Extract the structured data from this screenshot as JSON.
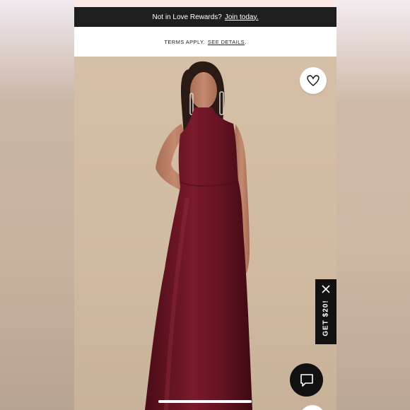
{
  "promo": {
    "text": "Not in Love Rewards?",
    "link": "Join today."
  },
  "terms": {
    "text": "TERMS APPLY.",
    "link": "SEE DETAILS",
    "period": "."
  },
  "get20": {
    "label": "GET $20!",
    "close_icon": "close-icon"
  },
  "icons": {
    "favorite": "heart-icon",
    "chat": "chat-bubble-icon"
  },
  "colors": {
    "promo_bar": "#1e1e1e",
    "dress": "#6e1524",
    "background": "#d3bca4",
    "top_strip": "#fde8e6"
  }
}
